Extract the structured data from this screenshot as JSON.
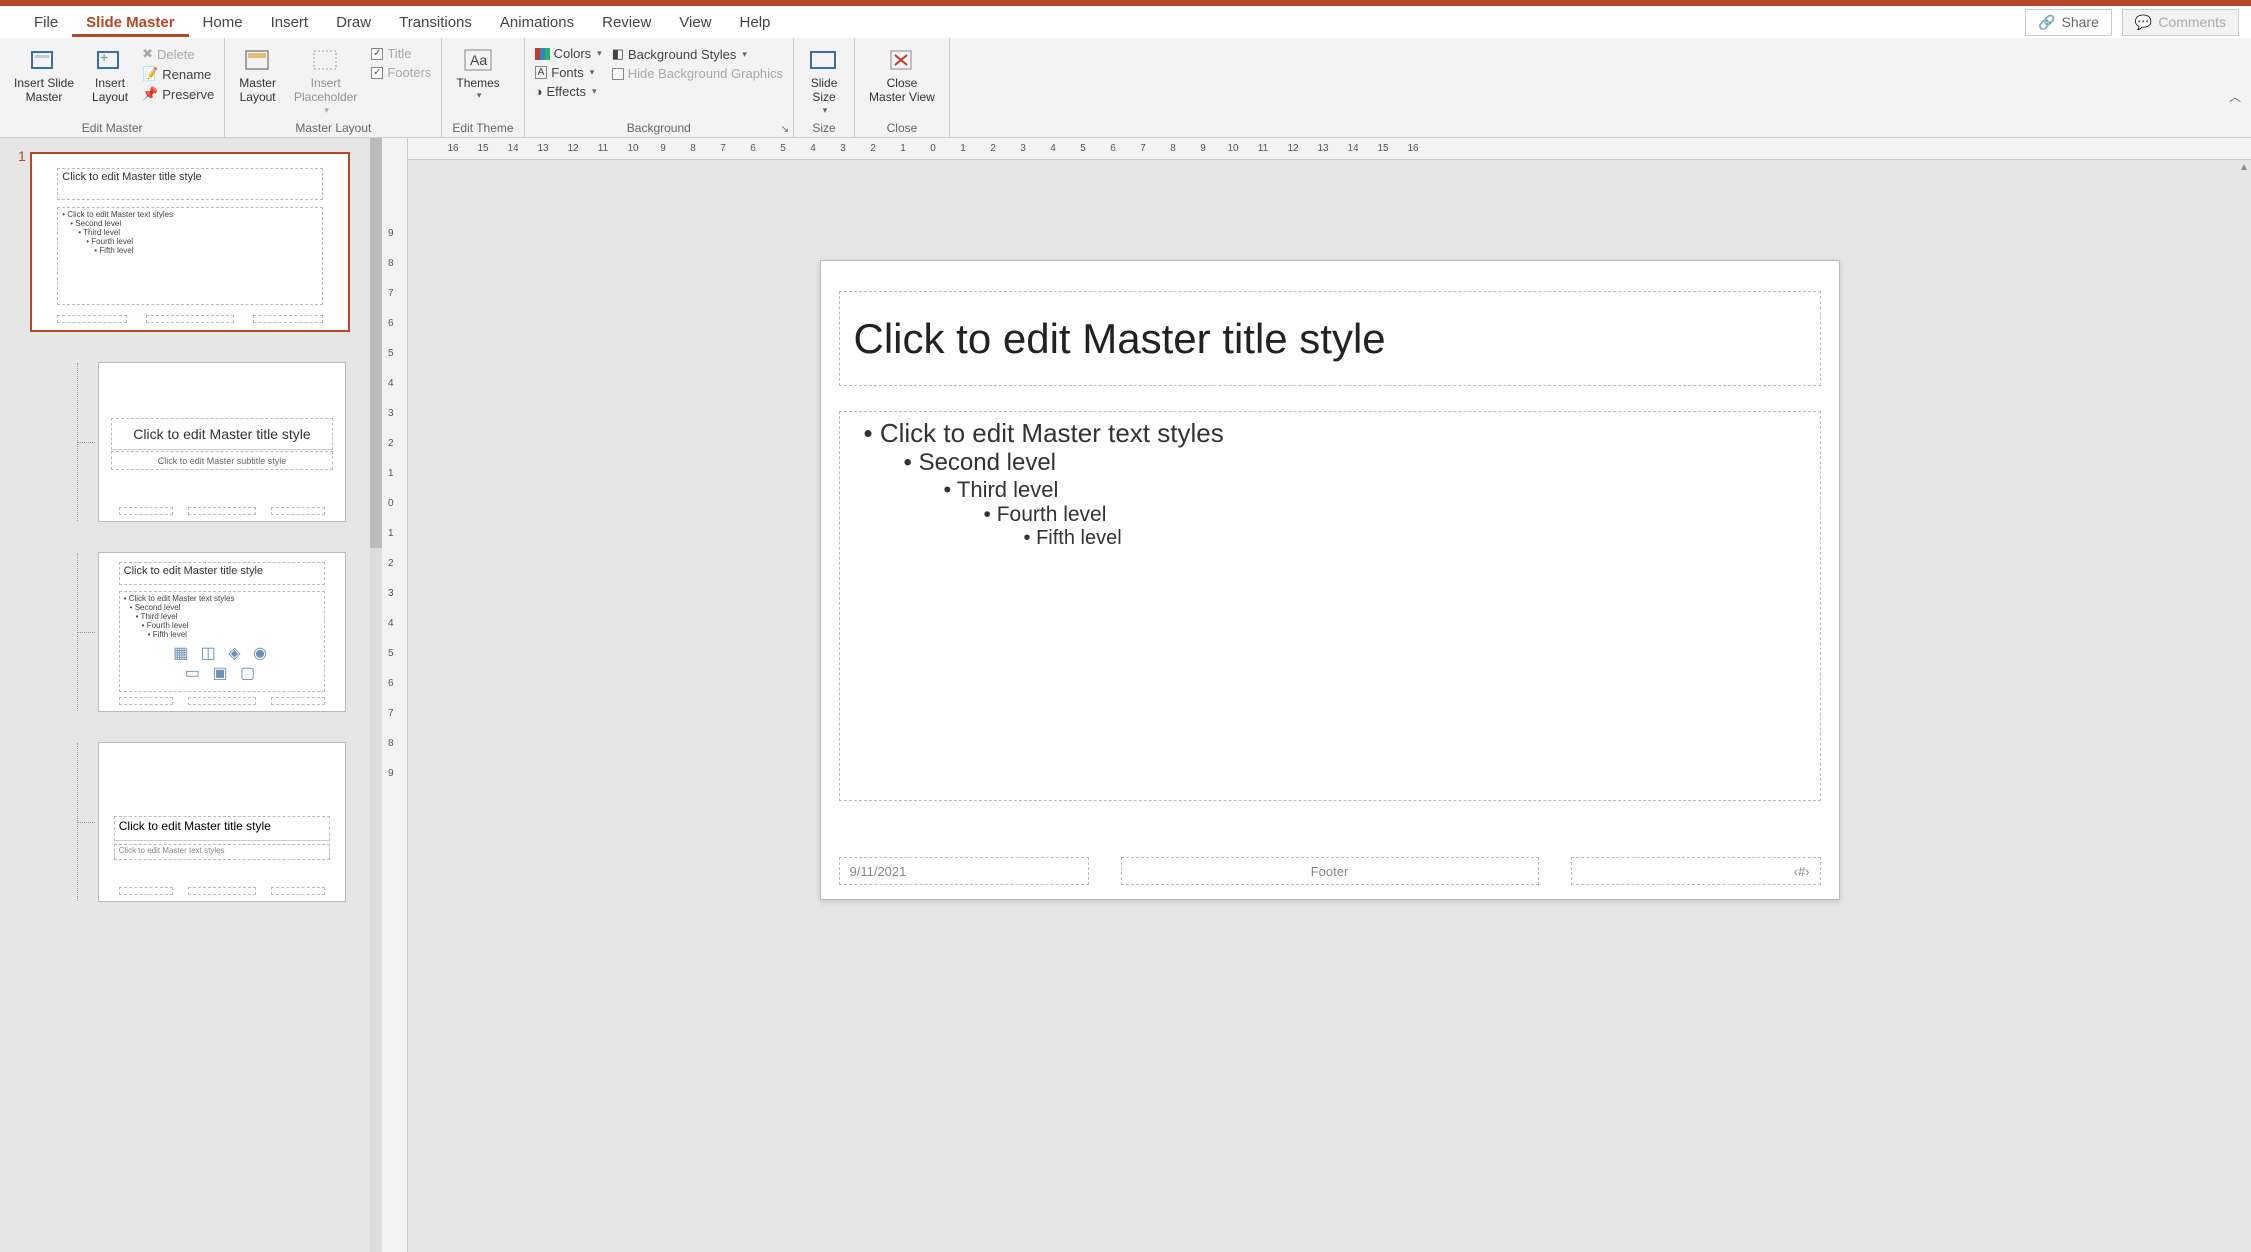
{
  "menubar": {
    "items": [
      "File",
      "Slide Master",
      "Home",
      "Insert",
      "Draw",
      "Transitions",
      "Animations",
      "Review",
      "View",
      "Help"
    ],
    "active": "Slide Master",
    "share": "Share",
    "comments": "Comments"
  },
  "ribbon": {
    "edit_master": {
      "insert_slide_master": "Insert Slide\nMaster",
      "insert_layout": "Insert\nLayout",
      "delete": "Delete",
      "rename": "Rename",
      "preserve": "Preserve",
      "label": "Edit Master"
    },
    "master_layout": {
      "master_layout": "Master\nLayout",
      "insert_placeholder": "Insert\nPlaceholder",
      "title": "Title",
      "footers": "Footers",
      "label": "Master Layout"
    },
    "edit_theme": {
      "themes": "Themes",
      "label": "Edit Theme"
    },
    "background": {
      "colors": "Colors",
      "fonts": "Fonts",
      "effects": "Effects",
      "bgstyles": "Background Styles",
      "hide_bg": "Hide Background Graphics",
      "label": "Background"
    },
    "size": {
      "slide_size": "Slide\nSize",
      "label": "Size"
    },
    "close": {
      "close_master": "Close\nMaster View",
      "label": "Close"
    }
  },
  "ruler_h": [
    "16",
    "15",
    "14",
    "13",
    "12",
    "11",
    "10",
    "9",
    "8",
    "7",
    "6",
    "5",
    "4",
    "3",
    "2",
    "1",
    "0",
    "1",
    "2",
    "3",
    "4",
    "5",
    "6",
    "7",
    "8",
    "9",
    "10",
    "11",
    "12",
    "13",
    "14",
    "15",
    "16"
  ],
  "ruler_v": [
    "9",
    "8",
    "7",
    "6",
    "5",
    "4",
    "3",
    "2",
    "1",
    "0",
    "1",
    "2",
    "3",
    "4",
    "5",
    "6",
    "7",
    "8",
    "9"
  ],
  "thumbs": {
    "num": "1",
    "master": {
      "title": "Click to edit Master title style",
      "body": [
        "• Click to edit Master text styles",
        "• Second level",
        "• Third level",
        "• Fourth level",
        "• Fifth level"
      ]
    },
    "layouts": [
      {
        "type": "title",
        "title": "Click to edit Master title style",
        "subtitle": "Click to edit Master subtitle style"
      },
      {
        "type": "content",
        "title": "Click to edit Master title style",
        "body": [
          "• Click to edit Master text styles",
          "• Second level",
          "• Third level",
          "• Fourth level",
          "• Fifth level"
        ]
      },
      {
        "type": "section",
        "title": "Click to edit Master title style",
        "subtitle": "Click to edit Master text styles"
      }
    ]
  },
  "slide": {
    "title": "Click to edit Master title style",
    "levels": [
      "Click to edit Master text styles",
      "Second level",
      "Third level",
      "Fourth level",
      "Fifth level"
    ],
    "date": "9/11/2021",
    "footer": "Footer",
    "slidenum": "‹#›"
  }
}
